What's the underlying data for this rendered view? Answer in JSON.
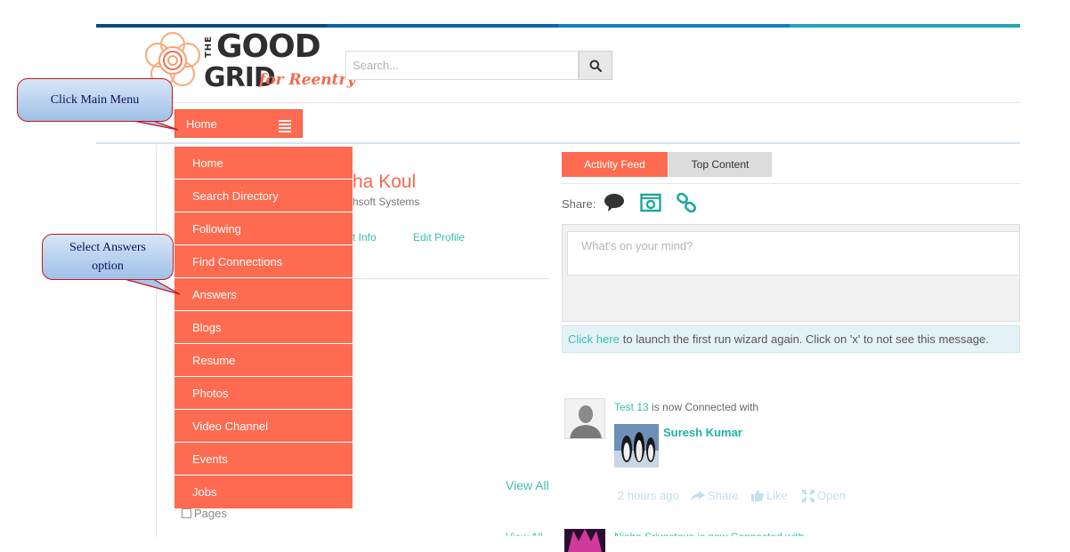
{
  "brand": {
    "logo_top": "THE",
    "logo_good": "GOOD",
    "logo_grid": "GRID",
    "logo_tagline": "for Reentry",
    "accent_color": "#ff6b50",
    "teal_color": "#3bbfae"
  },
  "search": {
    "placeholder": "Search..."
  },
  "main_menu": {
    "label": "Home"
  },
  "dropdown": {
    "items": [
      "Home",
      "Search Directory",
      "Following",
      "Find Connections",
      "Answers",
      "Blogs",
      "Resume",
      "Photos",
      "Video Channel",
      "Events",
      "Jobs"
    ]
  },
  "profile": {
    "name_partial": "ha Koul",
    "company_partial": "hsoft Systems",
    "contact_partial": "t Info",
    "edit_profile": "Edit Profile",
    "view_all": "View All",
    "pages_partial": "Pages",
    "view_all_2": "View All"
  },
  "feed": {
    "tabs": [
      "Activity Feed",
      "Top Content"
    ],
    "share_label": "Share:",
    "post_placeholder": "What's on your mind?",
    "wizard_link": "Click here",
    "wizard_text": "to launch the first run wizard again. Click on 'x' to not see this message.",
    "item1": {
      "actor": "Test 13",
      "action": " is now Connected with",
      "friend": "Suresh Kumar",
      "time": "2 hours ago",
      "share": "Share",
      "like": "Like",
      "open": "Open"
    },
    "item2": {
      "line": "Nisha Srivastava is now Connected with"
    }
  },
  "callouts": {
    "main_menu": "Click Main Menu",
    "answers_line1": "Select Answers",
    "answers_line2": "option"
  }
}
